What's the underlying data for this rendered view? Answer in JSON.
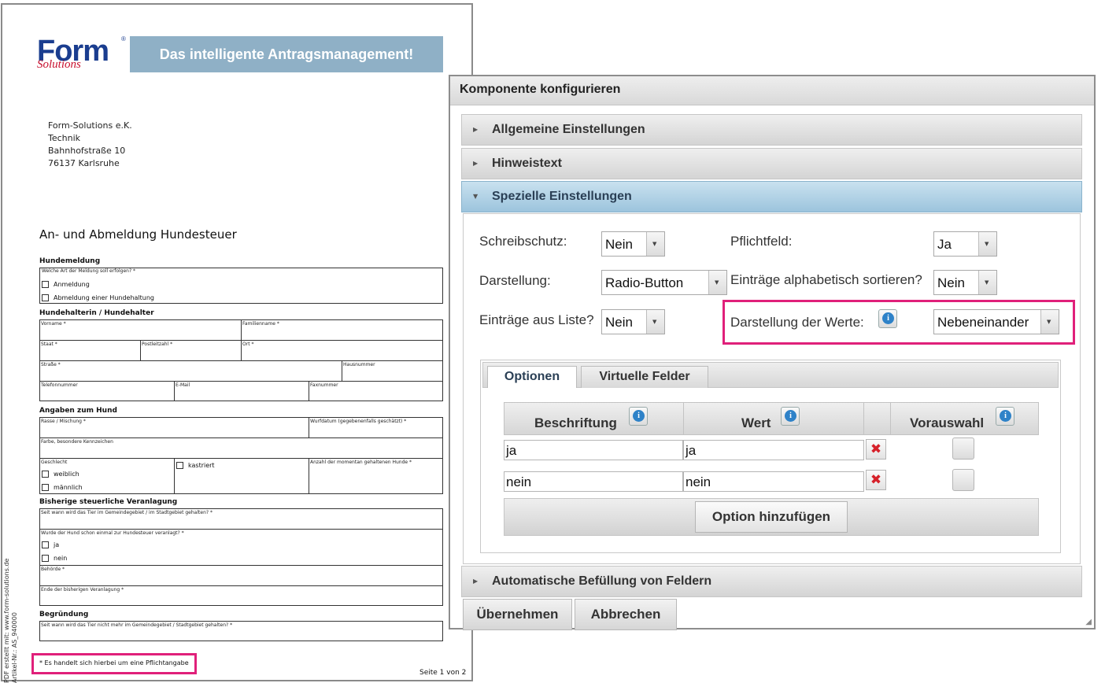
{
  "pdf": {
    "logo_text": "Form",
    "logo_sub": "Solutions",
    "logo_reg": "®",
    "banner": "Das intelligente Antragsmanagement!",
    "address": [
      "Form-Solutions e.K.",
      "Technik",
      "Bahnhofstraße 10",
      "76137 Karlsruhe"
    ],
    "title": "An- und Abmeldung Hundesteuer",
    "sections": {
      "hundemeldung": "Hundemeldung",
      "halter": "Hundehalterin / Hundehalter",
      "angaben": "Angaben zum Hund",
      "bisherige": "Bisherige steuerliche Veranlagung",
      "begruendung": "Begründung"
    },
    "labels": {
      "art": "Welche Art der Meldung soll erfolgen? *",
      "anmeldung": "Anmeldung",
      "abmeldung": "Abmeldung einer Hundehaltung",
      "vorname": "Vorname *",
      "familienname": "Familienname *",
      "staat": "Staat *",
      "plz": "Postleitzahl *",
      "ort": "Ort *",
      "strasse": "Straße *",
      "hausnummer": "Hausnummer",
      "telefon": "Telefonnummer",
      "email": "E-Mail",
      "fax": "Faxnummer",
      "rasse": "Rasse / Mischung *",
      "wurfdatum": "Wurfdatum (gegebenenfalls geschätzt) *",
      "farbe": "Farbe, besondere Kennzeichen",
      "geschlecht": "Geschlecht",
      "kastriert": "kastriert",
      "anzahl": "Anzahl der momentan gehaltenen Hunde *",
      "weiblich": "weiblich",
      "maennlich": "männlich",
      "seitwann": "Seit wann wird das Tier im Gemeindegebiet / im Stadtgebiet gehalten? *",
      "veranlagt": "Wurde der Hund schon einmal zur Hundesteuer veranlagt? *",
      "ja": "ja",
      "nein": "nein",
      "behoerde": "Behörde *",
      "ende": "Ende der bisherigen Veranlagung *",
      "nichtmehr": "Seit wann wird das Tier nicht mehr im Gemeindegebiet / Stadtgebiet gehalten? *"
    },
    "pflicht": "* Es handelt sich hierbei um eine Pflichtangabe",
    "seite": "Seite 1 von 2",
    "side_line1": "PDF erstellt mit: www.form-solutions.de",
    "side_line2": "Artikel-Nr.: AS_940000"
  },
  "dialog": {
    "title": "Komponente konfigurieren",
    "sections": [
      "Allgemeine Einstellungen",
      "Hinweistext",
      "Spezielle Einstellungen",
      "Automatische Befüllung von Feldern"
    ],
    "fields": {
      "schreibschutz_label": "Schreibschutz:",
      "schreibschutz_value": "Nein",
      "pflichtfeld_label": "Pflichtfeld:",
      "pflichtfeld_value": "Ja",
      "darstellung_label": "Darstellung:",
      "darstellung_value": "Radio-Button",
      "sortieren_label": "Einträge alphabetisch sortieren?",
      "sortieren_value": "Nein",
      "liste_label": "Einträge aus Liste?",
      "liste_value": "Nein",
      "werte_label": "Darstellung der Werte:",
      "werte_value": "Nebeneinander"
    },
    "tabs": [
      "Optionen",
      "Virtuelle Felder"
    ],
    "table": {
      "headers": [
        "Beschriftung",
        "Wert",
        "Vorauswahl"
      ],
      "rows": [
        {
          "beschriftung": "ja",
          "wert": "ja",
          "delete_icon": "✖"
        },
        {
          "beschriftung": "nein",
          "wert": "nein",
          "delete_icon": "✖"
        }
      ]
    },
    "add_option": "Option hinzufügen",
    "apply": "Übernehmen",
    "cancel": "Abbrechen"
  },
  "colors": {
    "highlight": "#e0207a",
    "banner": "#8fb0c6",
    "active_section": "#9cc4dd"
  }
}
